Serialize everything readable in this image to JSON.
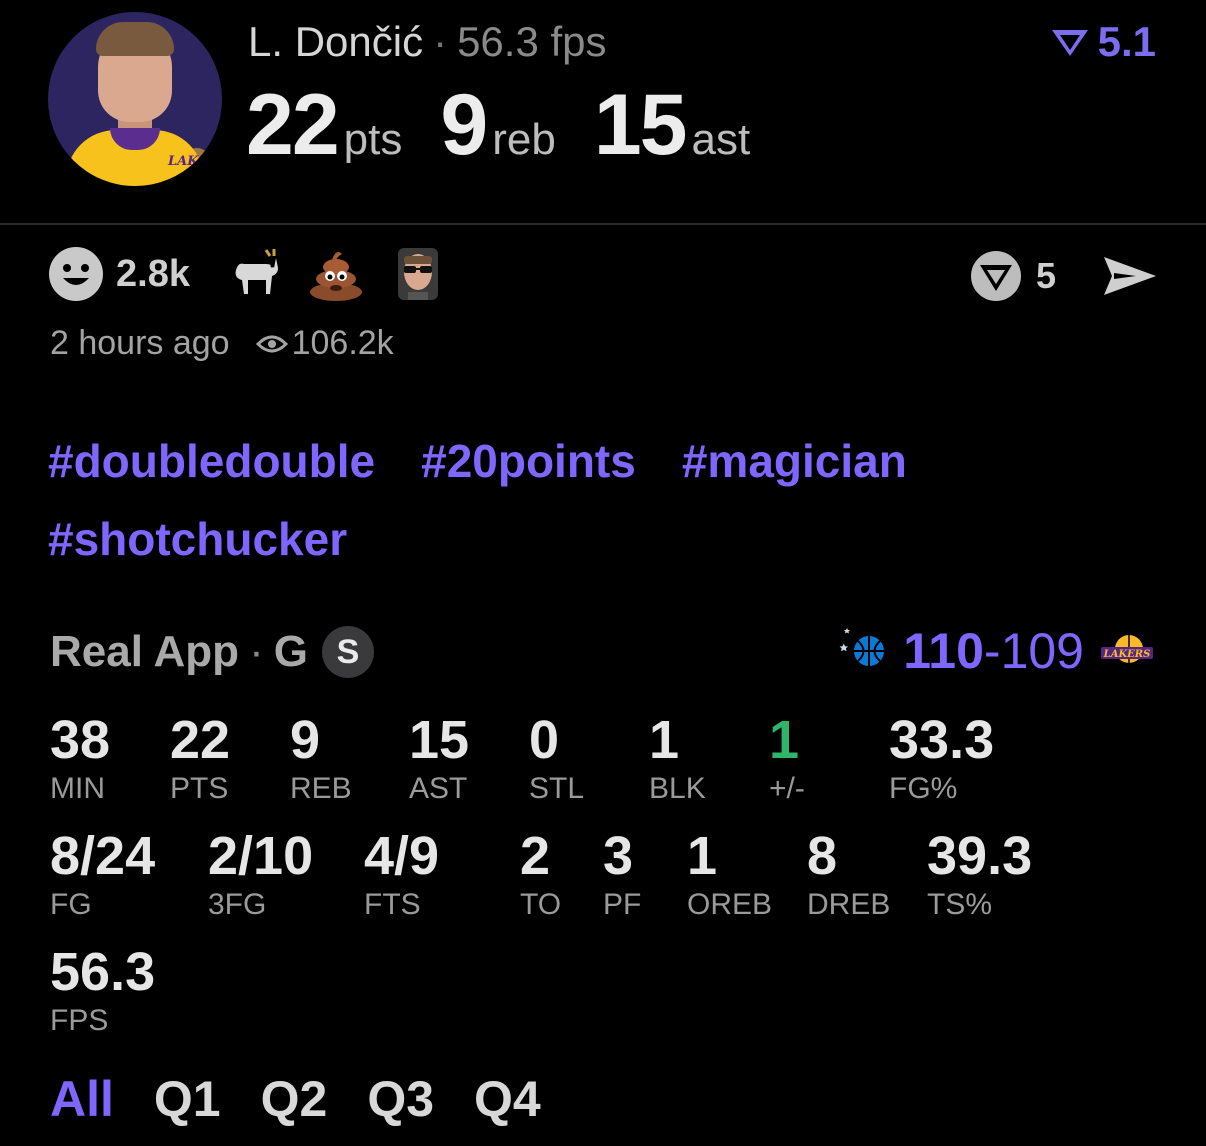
{
  "header": {
    "player_name": "L. Dončić",
    "separator": "·",
    "fps": "56.3 fps",
    "rating": "5.1",
    "pts_value": "22",
    "pts_label": "pts",
    "reb_value": "9",
    "reb_label": "reb",
    "ast_value": "15",
    "ast_label": "ast",
    "team_logo_text": "LAKERS"
  },
  "reactions": {
    "count": "2.8k",
    "emojis": [
      "smiley-icon",
      "goat-emoji",
      "poop-emoji",
      "player-sunglasses-emoji"
    ],
    "vote_count": "5",
    "time_ago": "2 hours ago",
    "views": "106.2k"
  },
  "hashtags": [
    "#doubledouble",
    "#20points",
    "#magician",
    "#shotchucker"
  ],
  "game": {
    "source": "Real App",
    "separator": "·",
    "position": "G",
    "badge": "S",
    "score_a": "110",
    "score_dash": "-",
    "score_b": "109",
    "team_b_logo_text": "LAKERS"
  },
  "stats_row1": [
    {
      "value": "38",
      "label": "MIN"
    },
    {
      "value": "22",
      "label": "PTS"
    },
    {
      "value": "9",
      "label": "REB"
    },
    {
      "value": "15",
      "label": "AST"
    },
    {
      "value": "0",
      "label": "STL"
    },
    {
      "value": "1",
      "label": "BLK"
    },
    {
      "value": "1",
      "label": "+/-"
    },
    {
      "value": "33.3",
      "label": "FG%"
    }
  ],
  "stats_row2": [
    {
      "value": "8/24",
      "label": "FG"
    },
    {
      "value": "2/10",
      "label": "3FG"
    },
    {
      "value": "4/9",
      "label": "FTS"
    },
    {
      "value": "2",
      "label": "TO"
    },
    {
      "value": "3",
      "label": "PF"
    },
    {
      "value": "1",
      "label": "OREB"
    },
    {
      "value": "8",
      "label": "DREB"
    },
    {
      "value": "39.3",
      "label": "TS%"
    }
  ],
  "stats_row3": [
    {
      "value": "56.3",
      "label": "FPS"
    }
  ],
  "tabs": [
    "All",
    "Q1",
    "Q2",
    "Q3",
    "Q4"
  ],
  "colors": {
    "accent": "#7f66ff",
    "positive": "#2fb56a",
    "background": "#000000"
  }
}
